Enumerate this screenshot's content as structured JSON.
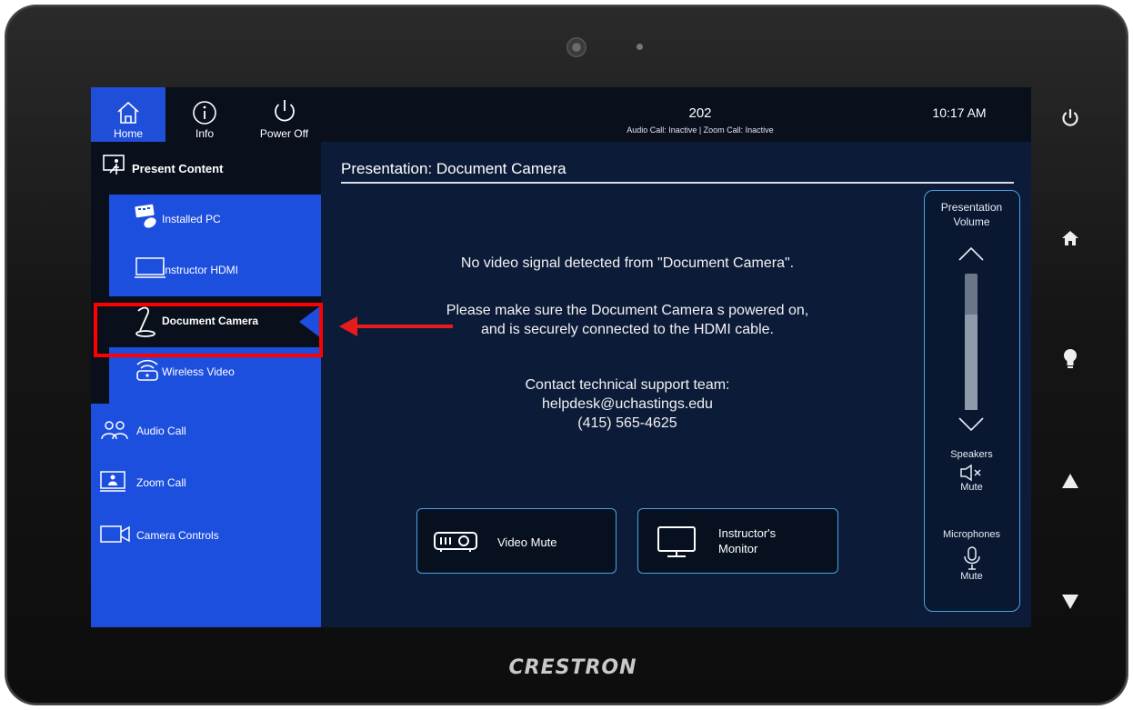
{
  "topbar": {
    "home_label": "Home",
    "info_label": "Info",
    "power_label": "Power Off",
    "room": "202",
    "call_status": "Audio Call: Inactive | Zoom Call: Inactive",
    "time": "10:17 AM"
  },
  "sidebar": {
    "header": "Present Content",
    "sub_items": [
      {
        "label": "Installed PC",
        "icon": "keyboard-mouse-icon"
      },
      {
        "label": "Instructor HDMI",
        "icon": "laptop-icon"
      },
      {
        "label": "Document Camera",
        "icon": "document-camera-icon",
        "active": true
      },
      {
        "label": "Wireless Video",
        "icon": "wireless-icon"
      }
    ],
    "items": [
      {
        "label": "Audio Call",
        "icon": "people-icon"
      },
      {
        "label": "Zoom Call",
        "icon": "presenter-icon"
      },
      {
        "label": "Camera Controls",
        "icon": "video-camera-icon"
      }
    ]
  },
  "content": {
    "title": "Presentation: Document Camera",
    "message1": "No video signal detected from \"Document Camera\".",
    "message2_line1": "Please make sure the Document Camera s powered on,",
    "message2_line2": "and is securely connected to the HDMI cable.",
    "support_line1": "Contact technical support team:",
    "support_line2": "helpdesk@uchastings.edu",
    "support_line3": "(415) 565-4625",
    "video_mute_label": "Video Mute",
    "monitor_label_line1": "Instructor's",
    "monitor_label_line2": "Monitor"
  },
  "volume": {
    "title_line1": "Presentation",
    "title_line2": "Volume",
    "level": 0.7,
    "speakers_label": "Speakers",
    "speakers_mute": "Mute",
    "microphones_label": "Microphones",
    "microphones_mute": "Mute"
  },
  "device": {
    "brand": "CRESTRON"
  },
  "colors": {
    "accent_blue": "#1d4fde",
    "screen_bg": "#0c1c38",
    "annotation_red": "#ff0000"
  }
}
